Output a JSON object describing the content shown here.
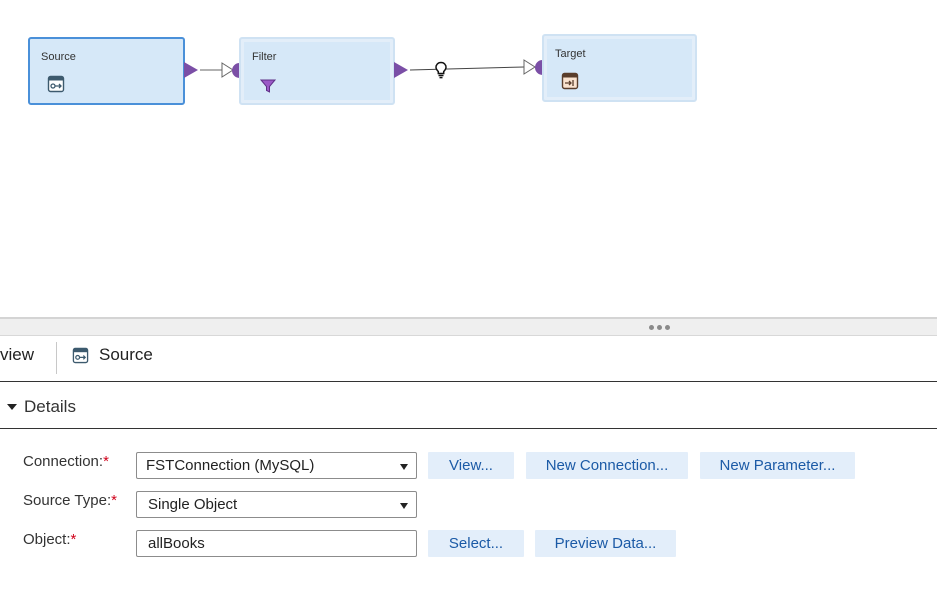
{
  "canvas": {
    "nodes": [
      {
        "label": "Source",
        "icon": "source-table-icon"
      },
      {
        "label": "Filter",
        "icon": "funnel-icon"
      },
      {
        "label": "Target",
        "icon": "target-table-icon"
      }
    ],
    "link_hint_icon": "lightbulb-icon"
  },
  "panel": {
    "prev_tab": "view",
    "current_tab": "Source",
    "current_tab_icon": "source-table-icon",
    "section": "Details",
    "fields": {
      "connection": {
        "label": "Connection:",
        "value": "FSTConnection (MySQL)"
      },
      "source_type": {
        "label": "Source Type:",
        "value": "Single Object"
      },
      "object": {
        "label": "Object:",
        "value": "allBooks"
      }
    },
    "required_mark": "*",
    "buttons": {
      "view": "View...",
      "new_connection": "New Connection...",
      "new_parameter": "New Parameter...",
      "select": "Select...",
      "preview_data": "Preview Data..."
    }
  },
  "colors": {
    "node_fill": "#d6e8f8",
    "selected_border": "#4a90d9",
    "port": "#7b4fa6",
    "button_bg": "#e3eefa",
    "button_text": "#1b5aa6",
    "required": "#d0021b"
  }
}
